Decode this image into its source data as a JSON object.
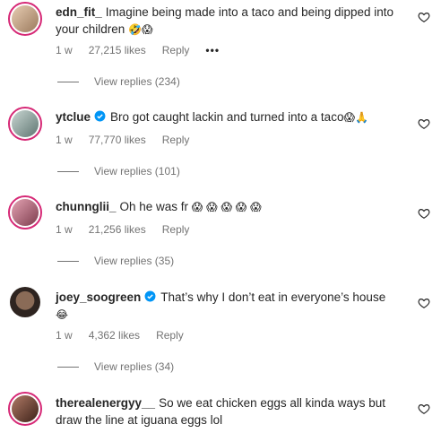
{
  "comments": [
    {
      "username": "edn_fit_",
      "verified": false,
      "text": "Imagine being made into a taco and being dipped into your children",
      "emojis": "🤣😱",
      "time": "1 w",
      "likes": "27,215 likes",
      "reply": "Reply",
      "more": "•••",
      "view_replies": "View replies (234)",
      "avatar_color": "#c9a88a"
    },
    {
      "username": "ytclue",
      "verified": true,
      "text": "Bro got caught lackin and turned into a taco",
      "emojis": "😱🙏",
      "time": "1 w",
      "likes": "77,770 likes",
      "reply": "Reply",
      "view_replies": "View replies (101)",
      "avatar_color": "#8fa3a0"
    },
    {
      "username": "chunnglii_",
      "verified": false,
      "text": "Oh he was fr",
      "emojis": "😱 😱 😱 😱 😱",
      "time": "1 w",
      "likes": "21,256 likes",
      "reply": "Reply",
      "view_replies": "View replies (35)",
      "avatar_color": "#b46a7d"
    },
    {
      "username": "joey_soogreen",
      "verified": true,
      "text": "That’s why I don’t eat in everyone’s house",
      "emojis": "😂",
      "time": "1 w",
      "likes": "4,362 likes",
      "reply": "Reply",
      "view_replies": "View replies (34)",
      "avatar_color": "#5b4a3f"
    },
    {
      "username": "therealenergyy__",
      "verified": false,
      "text": "So we eat chicken eggs all kinda ways but draw the line at iguana eggs lol",
      "emojis": "",
      "avatar_color": "#6b4636"
    }
  ],
  "colors": {
    "text": "#262626",
    "muted": "#737373",
    "verified": "#0095f6",
    "story_ring": "#d62976"
  }
}
